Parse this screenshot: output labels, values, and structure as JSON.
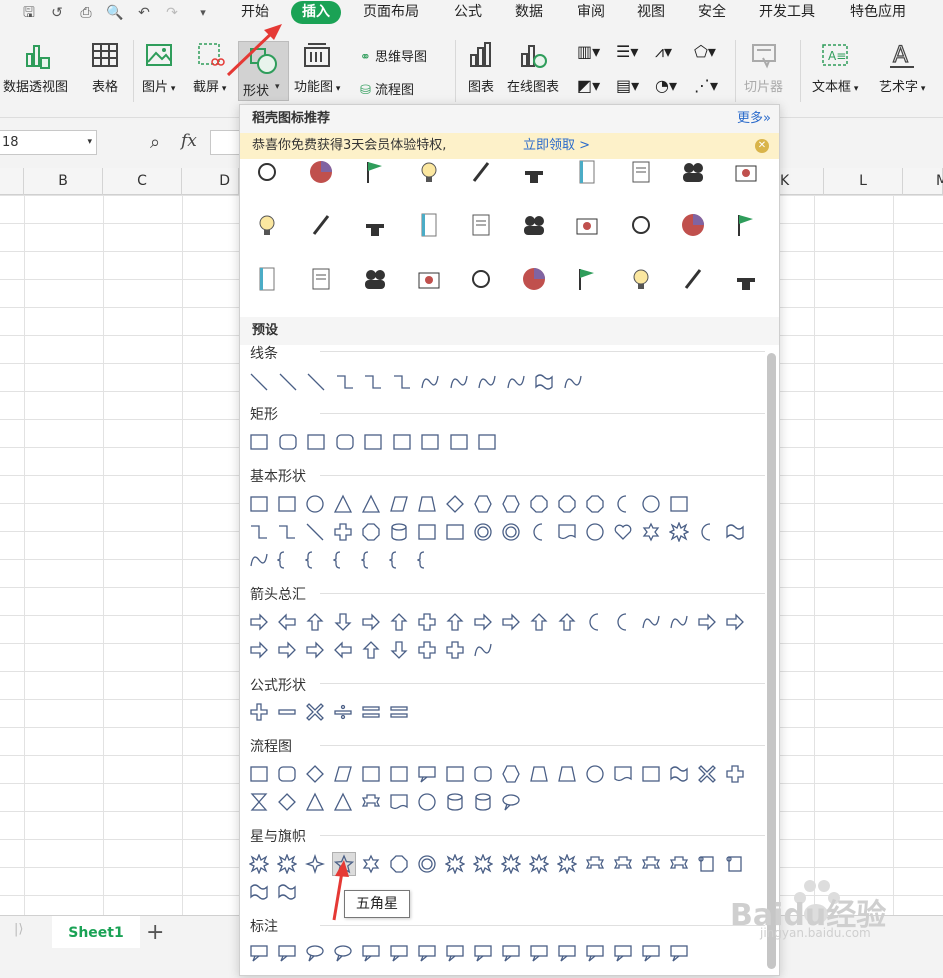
{
  "menubar": {
    "tabs": [
      "开始",
      "插入",
      "页面布局",
      "公式",
      "数据",
      "审阅",
      "视图",
      "安全",
      "开发工具",
      "特色应用"
    ],
    "active_tab": "插入",
    "active_color": "#1aa255"
  },
  "ribbon": {
    "pivot": "数据透视图",
    "table": "表格",
    "picture": "图片",
    "screenshot": "截屏",
    "shape": "形状",
    "function_chart": "功能图",
    "mindmap": "思维导图",
    "flowchart": "流程图",
    "chart": "图表",
    "online_chart": "在线图表",
    "slicer": "切片器",
    "textbox": "文本框",
    "wordart": "艺术字"
  },
  "formula_bar": {
    "name_box": "18",
    "fx": "fx"
  },
  "columns": [
    "B",
    "C",
    "D",
    "K",
    "L",
    "M"
  ],
  "panel": {
    "header": "稻壳图标推荐",
    "more": "更多»",
    "promo_text": "恭喜你免费获得3天会员体验特权,",
    "promo_link": "立即领取 >",
    "preset": "预设",
    "sections": {
      "lines": "线条",
      "rect": "矩形",
      "basic": "基本形状",
      "arrows": "箭头总汇",
      "equation": "公式形状",
      "flow": "流程图",
      "stars": "星与旗帜",
      "callouts": "标注"
    },
    "tooltip": "五角星"
  },
  "sheets": [
    "Sheet1"
  ],
  "watermark": {
    "main": "Baidu经验",
    "sub": "jingyan.baidu.com"
  },
  "colors": {
    "accent": "#1aa255",
    "shape_stroke": "#4a5f86",
    "link": "#2b6bcb",
    "arrow": "#e53935"
  }
}
